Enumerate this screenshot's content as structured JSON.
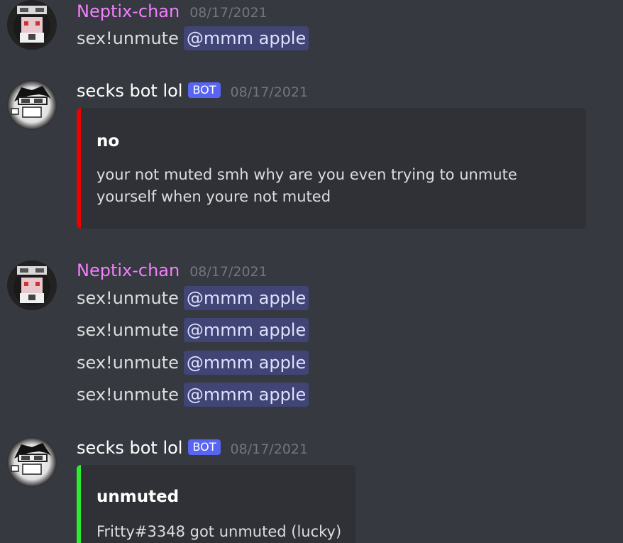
{
  "messages": [
    {
      "author": "Neptix-chan",
      "timestamp": "08/17/2021",
      "lines": [
        {
          "command": "sex!unmute",
          "mention": "@mmm apple"
        }
      ]
    },
    {
      "author": "secks bot lol",
      "bot_tag": "BOT",
      "timestamp": "08/17/2021",
      "embed": {
        "color": "#ed0000",
        "title": "no",
        "description": "your not muted smh why are you even trying to unmute yourself when youre not muted"
      }
    },
    {
      "author": "Neptix-chan",
      "timestamp": "08/17/2021",
      "lines": [
        {
          "command": "sex!unmute",
          "mention": "@mmm apple"
        },
        {
          "command": "sex!unmute",
          "mention": "@mmm apple"
        },
        {
          "command": "sex!unmute",
          "mention": "@mmm apple"
        },
        {
          "command": "sex!unmute",
          "mention": "@mmm apple"
        }
      ]
    },
    {
      "author": "secks bot lol",
      "bot_tag": "BOT",
      "timestamp": "08/17/2021",
      "embed": {
        "color": "#2bed2b",
        "title": "unmuted",
        "description": "Fritty#3348 got unmuted (lucky)"
      }
    }
  ],
  "theme": {
    "background": "#36393f",
    "embed_background": "#2f3136",
    "human_name_color": "#f47fff",
    "bot_tag_color": "#5865f2",
    "mention_color": "#dee0fc"
  }
}
